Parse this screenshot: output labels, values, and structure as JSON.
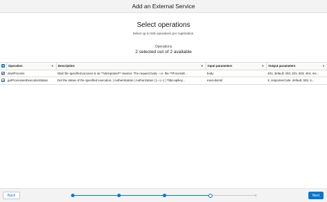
{
  "header": {
    "title": "Add an External Service"
  },
  "section": {
    "title": "Select operations",
    "subtitle": "Select up to 625 operations per registration."
  },
  "summary": {
    "label": "Operations",
    "value": "2 selected out of 2 available"
  },
  "table": {
    "columns": [
      "Operation",
      "Description",
      "Input parameters",
      "Output parameters"
    ],
    "rows": [
      {
        "selected": true,
        "operation": "startProcess",
        "description": "Start the specified process in an **idempotent** manner. The request body - i.e. the **ProcessE...",
        "input": "body",
        "output": "401, default, 403, 201, 503, 404, res..."
      },
      {
        "selected": true,
        "operation": "getProcessesExecutionStatus",
        "description": "Get the status of the specified execution. | Authentication | Authorization | |---|---| | *http-apikey...",
        "input": "executionId",
        "output": "4, responseCode, default, 503, 4..."
      }
    ]
  },
  "footer": {
    "back_label": "Back",
    "next_label": "Next",
    "steps_total": 5,
    "current_step": 4
  },
  "colors": {
    "accent": "#0176d3",
    "header_bg": "#f3f3f3"
  }
}
